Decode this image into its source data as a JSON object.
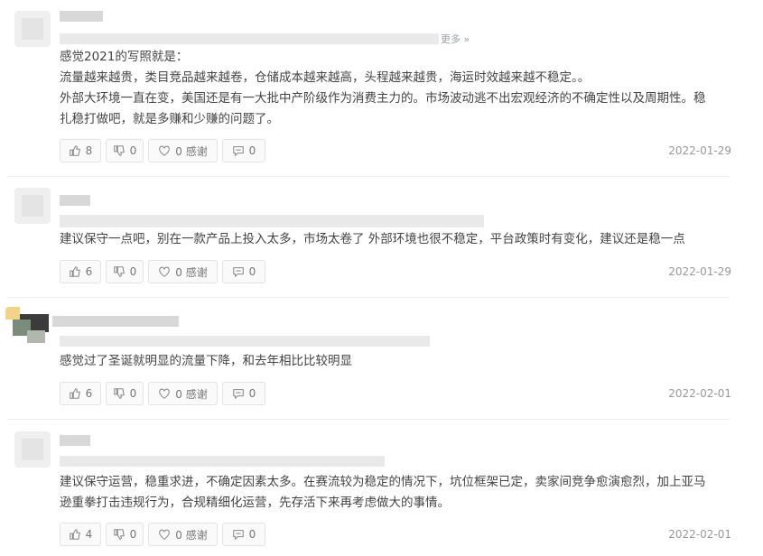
{
  "comments": [
    {
      "more": "更多 »",
      "lines": [
        "感觉2021的写照就是：",
        "流量越来越贵，类目竞品越来越卷，仓储成本越来越高，头程越来越贵，海运时效越来越不稳定。。",
        "外部大环境一直在变，美国还是有一大批中产阶级作为消费主力的。市场波动逃不出宏观经济的不确定性以及周期性。稳",
        "扎稳打做吧，就是多赚和少赚的问题了。"
      ],
      "likes": "8",
      "dislikes": "0",
      "thanks": "0 感谢",
      "replies": "0",
      "date": "2022-01-29"
    },
    {
      "lines": [
        "建议保守一点吧，别在一款产品上投入太多，市场太卷了 外部环境也很不稳定，平台政策时有变化，建议还是稳一点"
      ],
      "likes": "6",
      "dislikes": "0",
      "thanks": "0 感谢",
      "replies": "0",
      "date": "2022-01-29"
    },
    {
      "lines": [
        "感觉过了圣诞就明显的流量下降，和去年相比比较明显"
      ],
      "likes": "6",
      "dislikes": "0",
      "thanks": "0 感谢",
      "replies": "0",
      "date": "2022-02-01"
    },
    {
      "lines": [
        "建议保守运营，稳重求进，不确定因素太多。在赛流较为稳定的情况下，坑位框架已定，卖家间竞争愈演愈烈，加上亚马",
        "逊重拳打击违规行为，合规精细化运营，先存活下来再考虑做大的事情。"
      ],
      "likes": "4",
      "dislikes": "0",
      "thanks": "0 感谢",
      "replies": "0",
      "date": "2022-02-01"
    }
  ],
  "icons": {
    "like": "thumbs-up-icon",
    "dislike": "thumbs-down-icon",
    "thanks": "heart-icon",
    "reply": "comment-icon"
  }
}
